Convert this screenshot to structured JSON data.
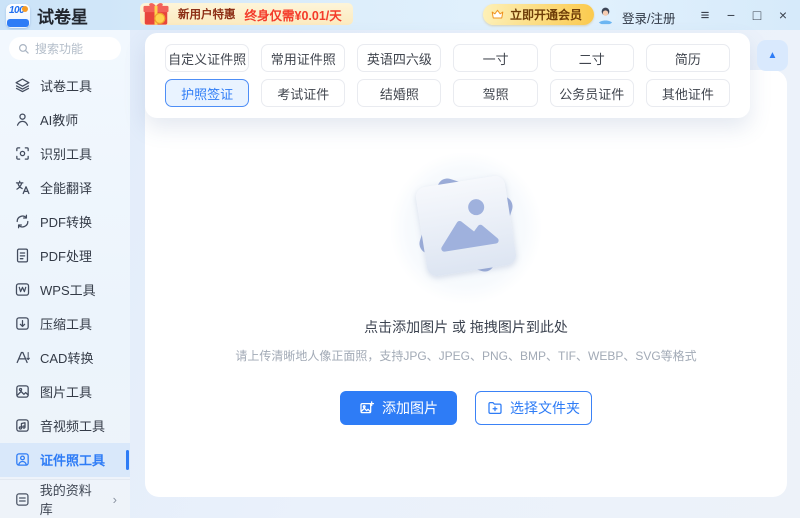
{
  "window": {
    "app_name": "试卷星",
    "logo_number": "100",
    "controls": {
      "menu": "≡",
      "minimize": "−",
      "maximize": "□",
      "close": "×"
    }
  },
  "topbar": {
    "promo": {
      "title": "新用户特惠",
      "price": "终身仅需¥0.01/天"
    },
    "member_button": "立即开通会员",
    "login": "登录/注册"
  },
  "sidebar": {
    "search_placeholder": "搜索功能",
    "items": [
      {
        "icon": "layers-icon",
        "label": "试卷工具"
      },
      {
        "icon": "ai-teacher-icon",
        "label": "AI教师"
      },
      {
        "icon": "recognize-icon",
        "label": "识别工具"
      },
      {
        "icon": "translate-icon",
        "label": "全能翻译"
      },
      {
        "icon": "pdf-convert-icon",
        "label": "PDF转换"
      },
      {
        "icon": "pdf-process-icon",
        "label": "PDF处理"
      },
      {
        "icon": "wps-icon",
        "label": "WPS工具"
      },
      {
        "icon": "compress-icon",
        "label": "压缩工具"
      },
      {
        "icon": "cad-convert-icon",
        "label": "CAD转换"
      },
      {
        "icon": "image-tools-icon",
        "label": "图片工具"
      },
      {
        "icon": "media-tools-icon",
        "label": "音视频工具"
      },
      {
        "icon": "id-photo-icon",
        "label": "证件照工具"
      }
    ],
    "active_item": "证件照工具",
    "library": {
      "label": "我的资料库",
      "chevron": "›"
    }
  },
  "tabs": {
    "items": [
      "自定义证件照",
      "常用证件照",
      "英语四六级",
      "一寸",
      "二寸",
      "简历",
      "护照签证",
      "考试证件",
      "结婚照",
      "驾照",
      "公务员证件",
      "其他证件"
    ],
    "active": "护照签证",
    "collapse_icon": "▲"
  },
  "upload": {
    "title": "点击添加图片 或 拖拽图片到此处",
    "hint": "请上传清晰地人像正面照，支持JPG、JPEG、PNG、BMP、TIF、WEBP、SVG等格式",
    "add_button": "添加图片",
    "folder_button": "选择文件夹"
  },
  "colors": {
    "accent": "#2e7cf6",
    "promo_red": "#f43b2a",
    "gold": "#fbca4e",
    "active_tab_bg": "#e9f3ff"
  }
}
